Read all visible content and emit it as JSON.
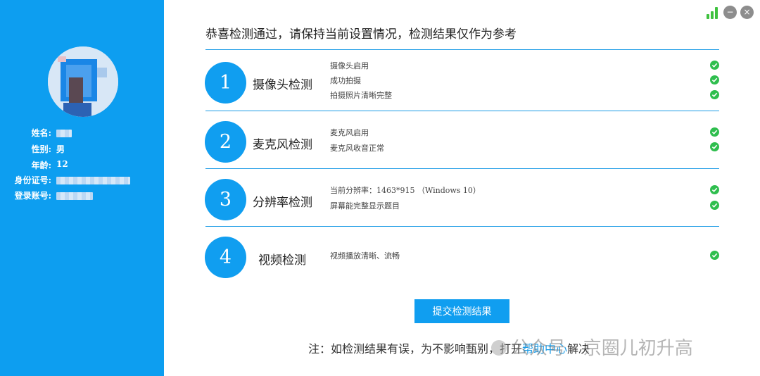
{
  "window_controls": {
    "minimize": "−",
    "close": "×"
  },
  "profile": {
    "labels": {
      "name": "姓名:",
      "gender": "性别:",
      "age": "年龄:",
      "id": "身份证号:",
      "account": "登录账号:"
    },
    "gender": "男",
    "age": "12"
  },
  "header": {
    "title": "恭喜检测通过，请保持当前设置情况，检测结果仅作为参考"
  },
  "sections": [
    {
      "number": "1",
      "title": "摄像头检测",
      "items": [
        "摄像头启用",
        "成功拍摄",
        "拍摄照片清晰完整"
      ]
    },
    {
      "number": "2",
      "title": "麦克风检测",
      "items": [
        "麦克风启用",
        "麦克风收音正常"
      ]
    },
    {
      "number": "3",
      "title": "分辨率检测",
      "items": [
        "当前分辨率：1463*915 （Windows 10）",
        "屏幕能完整显示题目"
      ]
    },
    {
      "number": "4",
      "title": "视频检测",
      "items": [
        "视频播放清晰、流畅"
      ]
    }
  ],
  "submit_label": "提交检测结果",
  "note": {
    "prefix": "注：如检测结果有误，为不影响甄别，打开",
    "link": "帮助中心",
    "suffix": "解决"
  },
  "watermark": "公众号 · 京圈儿初升高",
  "colors": {
    "sidebar": "#0d9ef0",
    "accent": "#109ef0",
    "check": "#2fbe4e"
  }
}
